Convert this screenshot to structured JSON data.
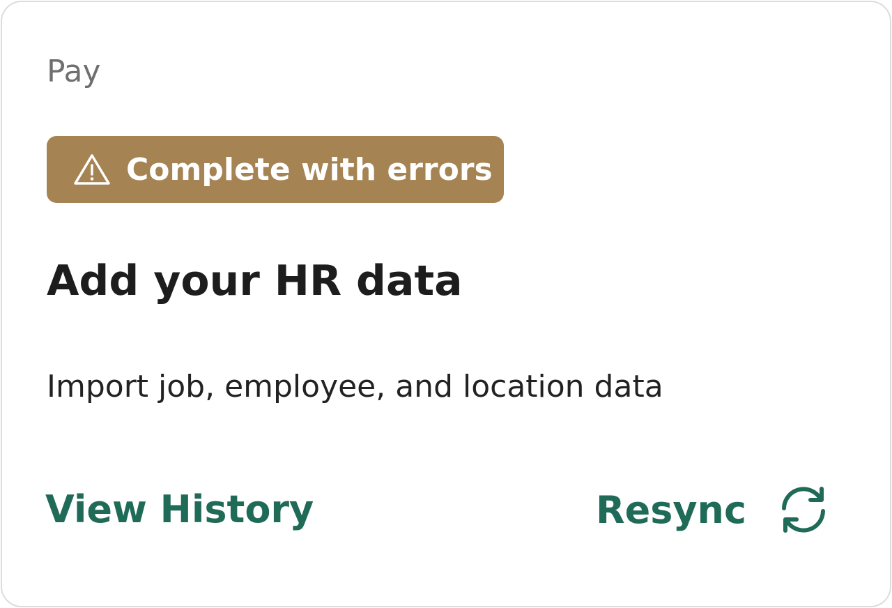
{
  "card": {
    "category": "Pay",
    "status_badge": {
      "label": "Complete with errors",
      "icon": "warning-triangle-icon",
      "color": "#a58353"
    },
    "title": "Add your HR data",
    "description": "Import job, employee, and location data",
    "actions": {
      "view_history_label": "View History",
      "resync_label": "Resync",
      "resync_icon": "refresh-icon",
      "accent_color": "#1f6b57"
    }
  }
}
